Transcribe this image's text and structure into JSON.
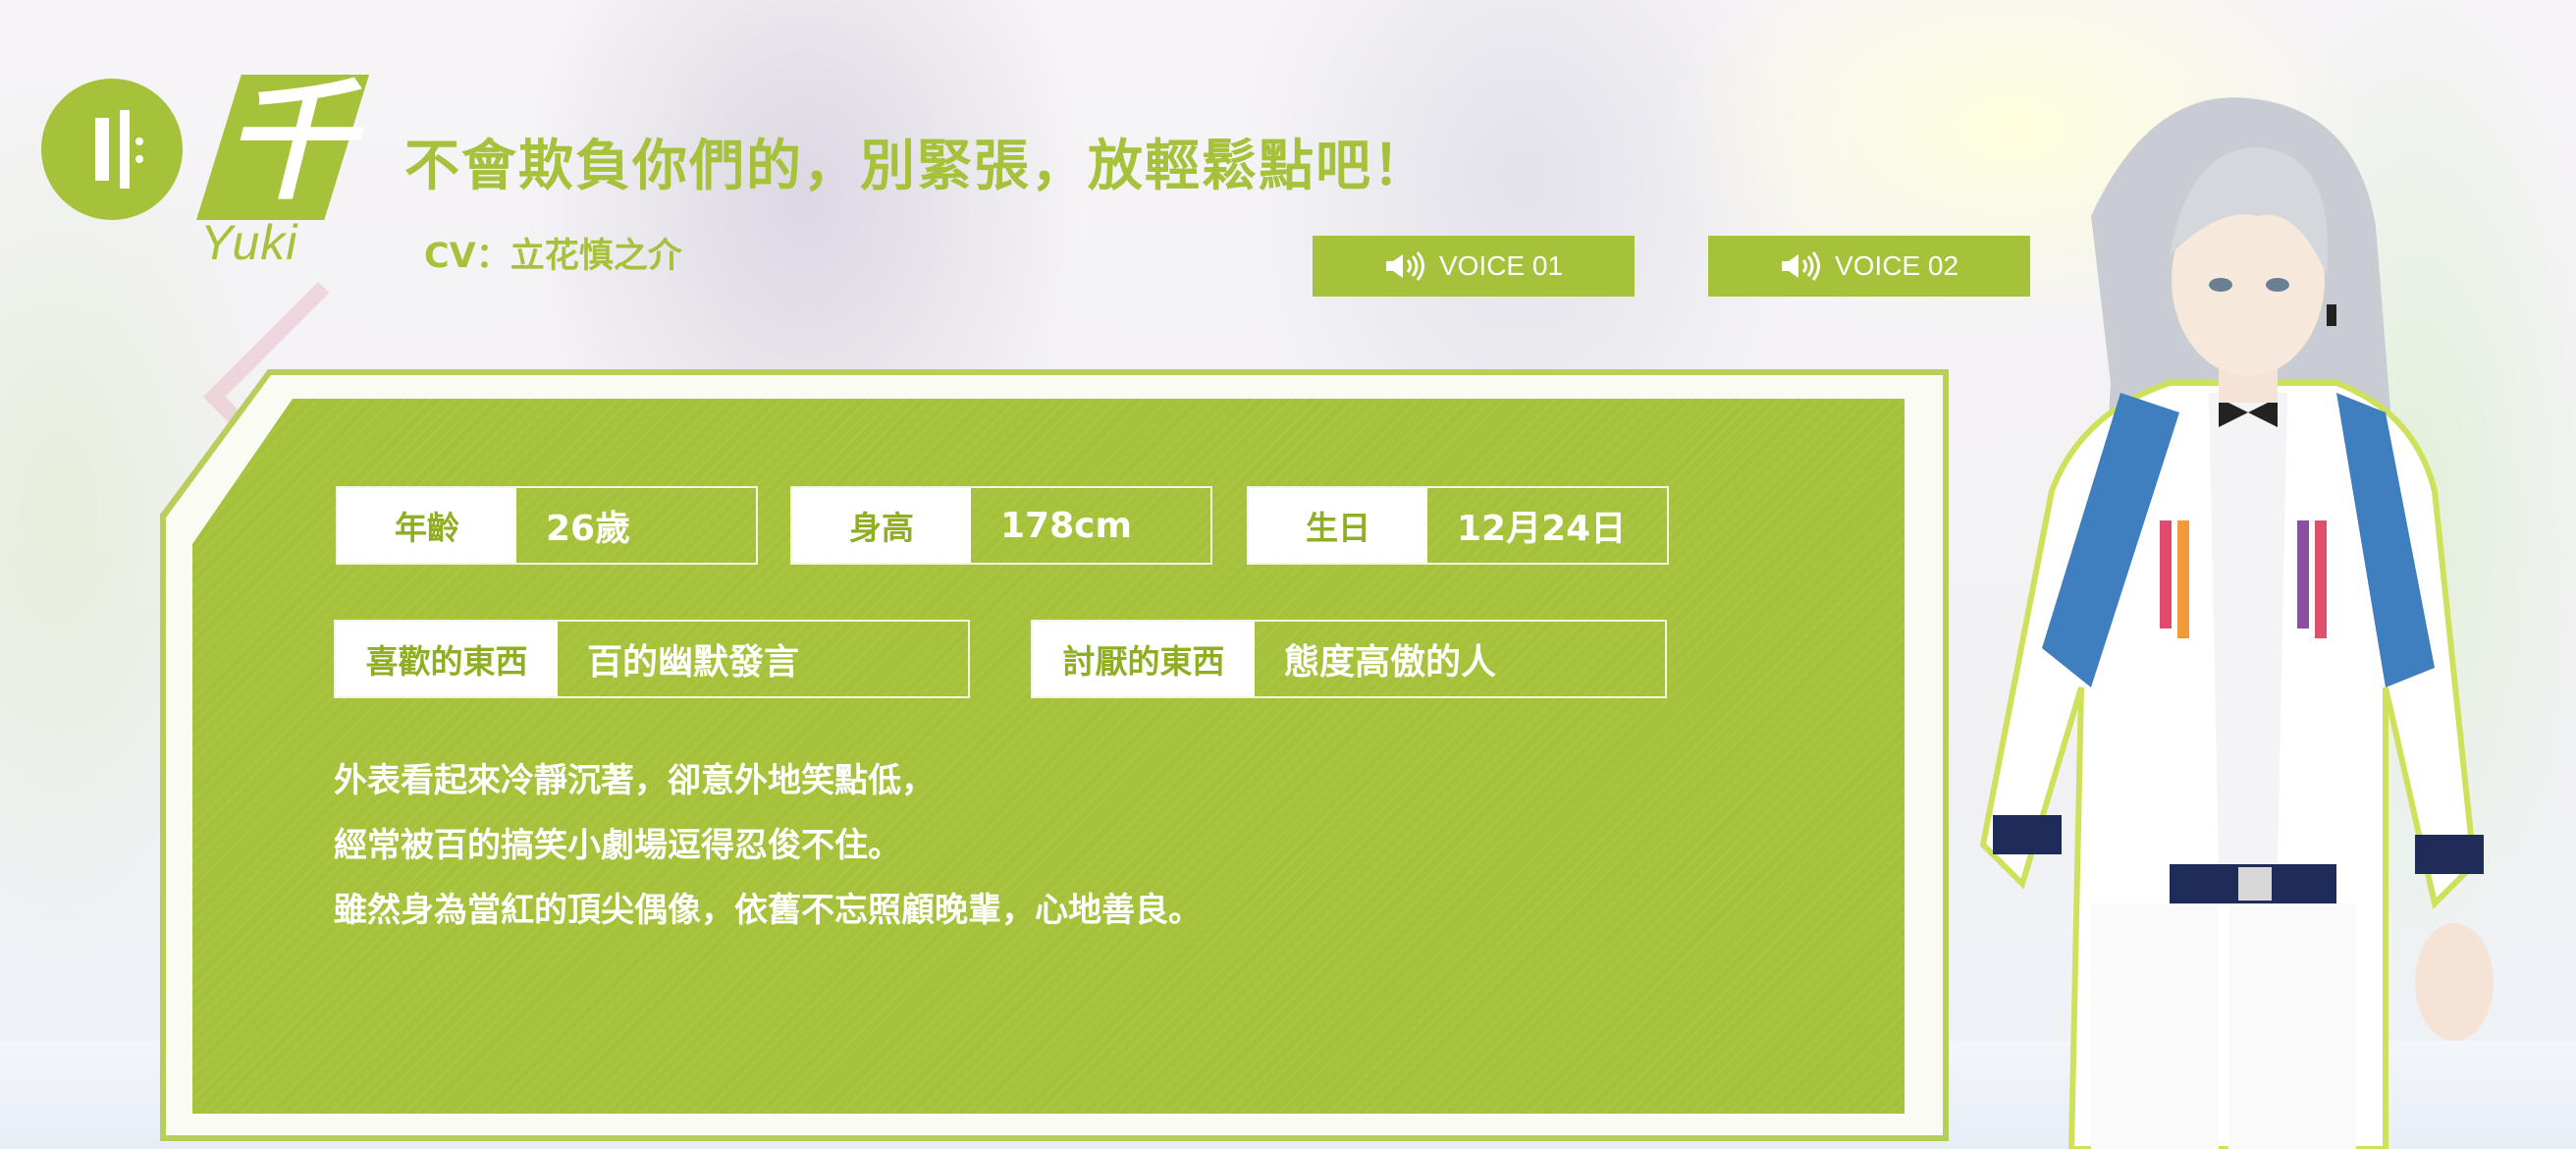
{
  "character": {
    "name_kanji": "千",
    "name_roman": "Yuki",
    "quote": "不會欺負你們的，別緊張，放輕鬆點吧！",
    "cv": "CV：立花慎之介"
  },
  "voice_buttons": [
    {
      "label": "VOICE 01",
      "icon": "speaker-icon"
    },
    {
      "label": "VOICE 02",
      "icon": "speaker-icon"
    }
  ],
  "profile": {
    "age": {
      "label": "年齡",
      "value": "26歲"
    },
    "height": {
      "label": "身高",
      "value": "178cm"
    },
    "birthday": {
      "label": "生日",
      "value": "12月24日"
    },
    "likes": {
      "label": "喜歡的東西",
      "value": "百的幽默發言"
    },
    "dislikes": {
      "label": "討厭的東西",
      "value": "態度高傲的人"
    },
    "description": [
      "外表看起來冷靜沉著，卻意外地笑點低，",
      "經常被百的搞笑小劇場逗得忍俊不住。",
      "雖然身為當紅的頂尖偶像，依舊不忘照顧晚輩，心地善良。"
    ]
  },
  "colors": {
    "accent": "#a6c13a",
    "label_text": "#8fae22",
    "background": "#f4f3f6"
  }
}
